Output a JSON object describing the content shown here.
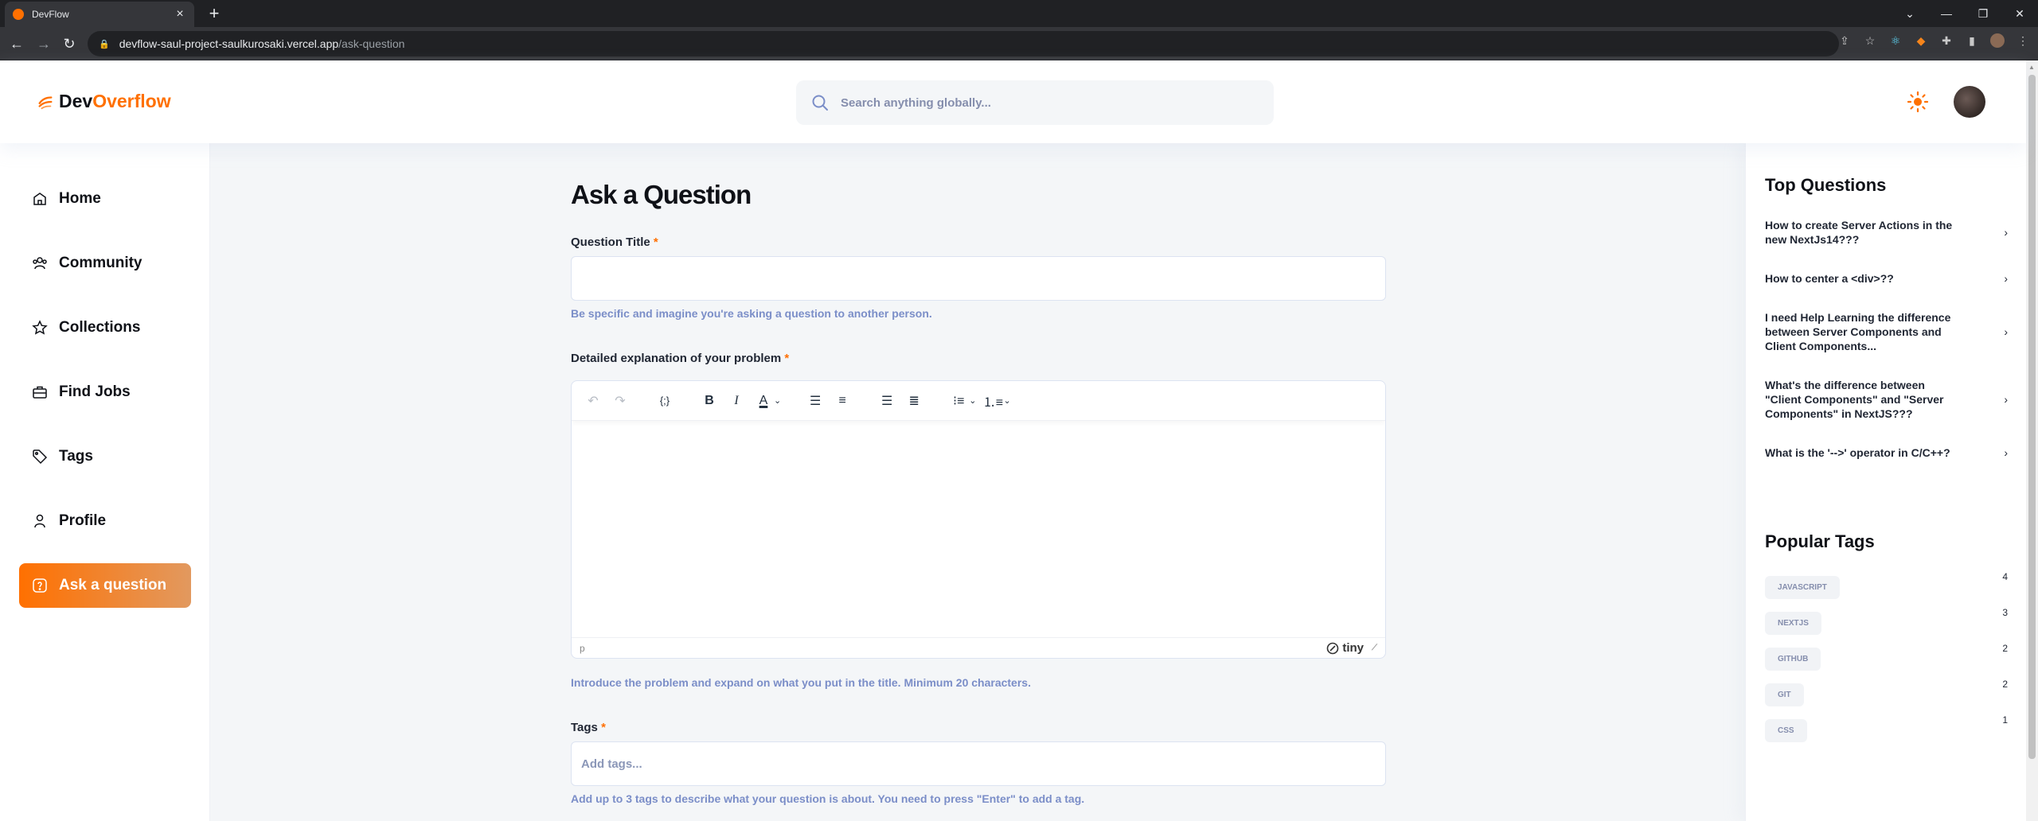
{
  "browser": {
    "tab_title": "DevFlow",
    "url_host": "devflow-saul-project-saulkurosaki.vercel.app",
    "url_path": "/ask-question"
  },
  "header": {
    "logo_prefix": "Dev",
    "logo_accent": "Overflow",
    "search_placeholder": "Search anything globally...",
    "accent_color": "#ff7000"
  },
  "sidebar": {
    "items": [
      {
        "label": "Home",
        "icon": "home-icon"
      },
      {
        "label": "Community",
        "icon": "users-icon"
      },
      {
        "label": "Collections",
        "icon": "star-icon"
      },
      {
        "label": "Find Jobs",
        "icon": "suitcase-icon"
      },
      {
        "label": "Tags",
        "icon": "tag-icon"
      },
      {
        "label": "Profile",
        "icon": "user-icon"
      }
    ],
    "ask_label": "Ask a question"
  },
  "form": {
    "page_title": "Ask a Question",
    "title_label": "Question Title",
    "required_mark": "*",
    "title_hint": "Be specific and imagine you're asking a question to another person.",
    "explanation_label": "Detailed explanation of your problem",
    "editor_status_path": "p",
    "editor_brand": "tiny",
    "explanation_hint": "Introduce the problem and expand on what you put in the title. Minimum 20 characters.",
    "tags_label": "Tags",
    "tags_placeholder": "Add tags...",
    "tags_hint": "Add up to 3 tags to describe what your question is about. You need to press \"Enter\" to add a tag."
  },
  "right_sidebar": {
    "top_questions_heading": "Top Questions",
    "questions": [
      "How to create Server Actions in the new NextJs14???",
      "How to center a <div>??",
      "I need Help Learning the difference between Server Components and Client Components...",
      "What's the difference between \"Client Components\" and \"Server Components\" in NextJS???",
      "What is the '-->' operator in C/C++?"
    ],
    "popular_tags_heading": "Popular Tags",
    "tags": [
      {
        "name": "JAVASCRIPT",
        "count": "4"
      },
      {
        "name": "NEXTJS",
        "count": "3"
      },
      {
        "name": "GITHUB",
        "count": "2"
      },
      {
        "name": "GIT",
        "count": "2"
      },
      {
        "name": "CSS",
        "count": "1"
      }
    ]
  }
}
